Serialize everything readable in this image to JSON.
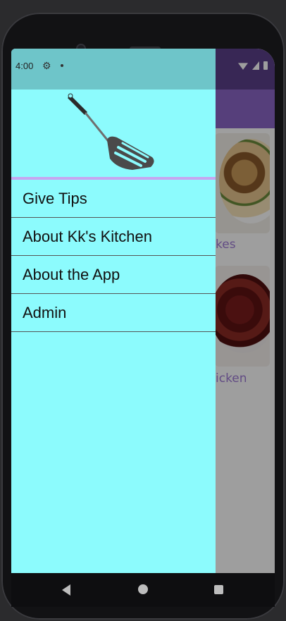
{
  "status": {
    "time": "4:00"
  },
  "background": {
    "cards": [
      {
        "title_fragment": "kes"
      },
      {
        "title_fragment": "icken"
      }
    ]
  },
  "drawer": {
    "menu": [
      {
        "label": "Give Tips"
      },
      {
        "label": "About Kk's Kitchen"
      },
      {
        "label": "About the App"
      },
      {
        "label": "Admin"
      }
    ]
  },
  "colors": {
    "drawer_background": "#8cfbfd",
    "drawer_status": "#6ec5c9",
    "app_toolbar": "#8c66c7",
    "divider_accent": "#c6a6f0"
  },
  "icons": [
    "settings-gear-icon",
    "notification-dot-icon",
    "wifi-icon",
    "signal-icon",
    "battery-icon",
    "chat-icon",
    "spatula-logo",
    "back-icon",
    "home-icon",
    "recents-icon"
  ]
}
